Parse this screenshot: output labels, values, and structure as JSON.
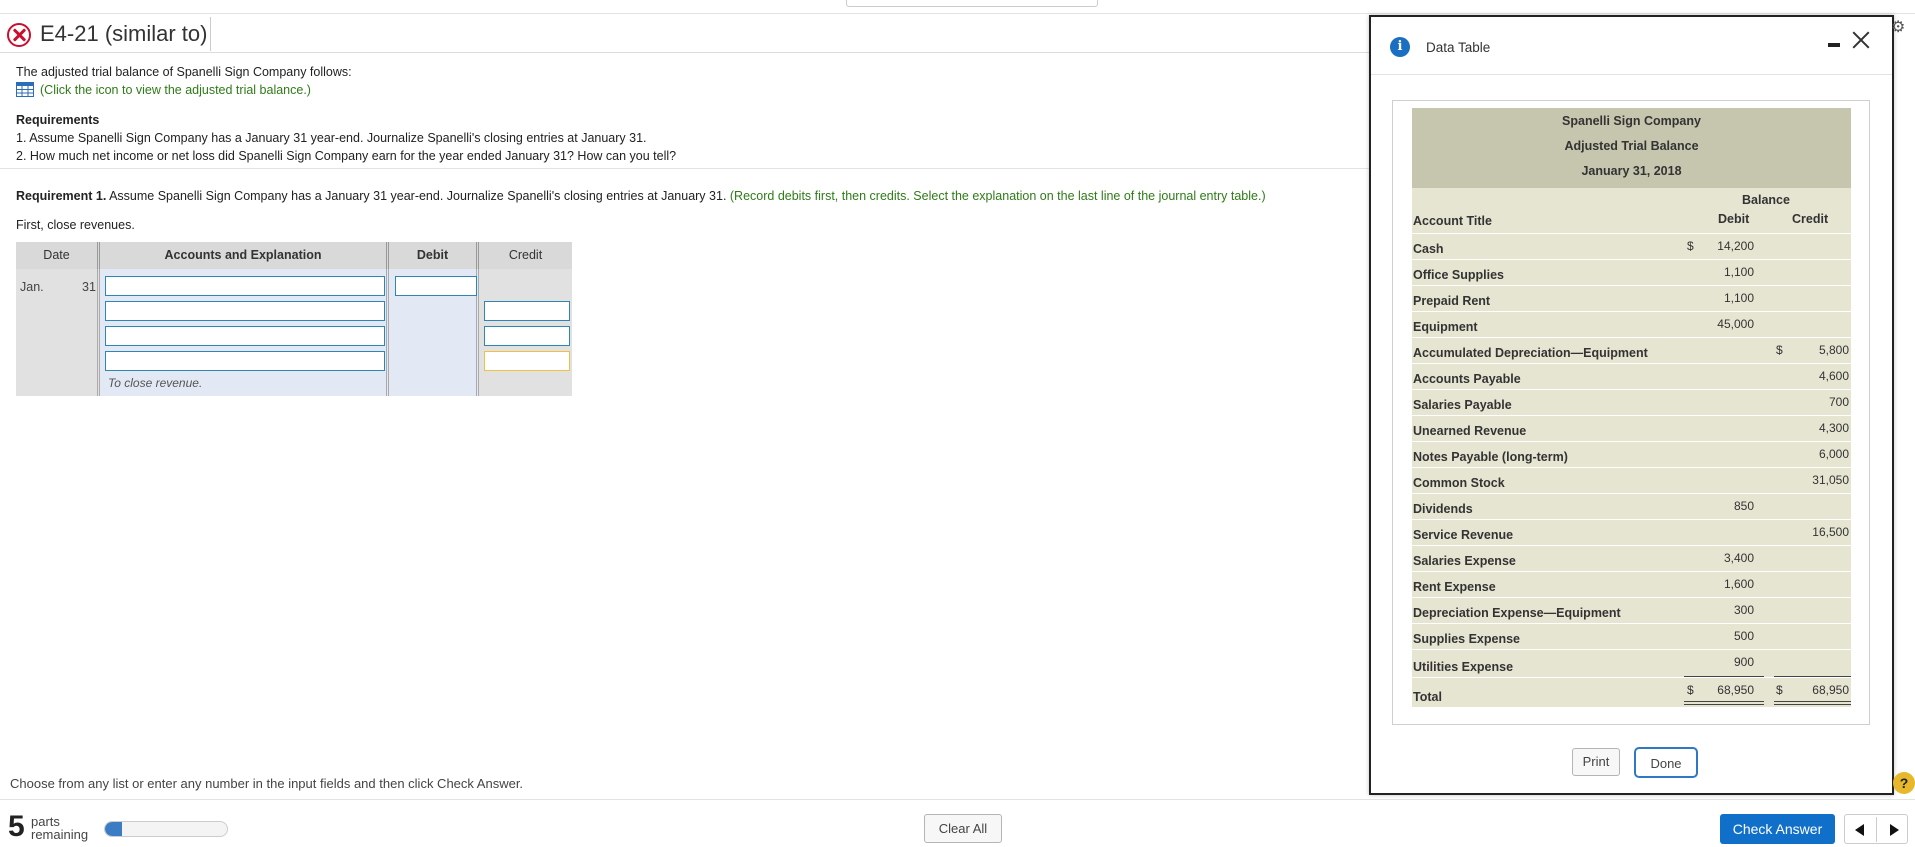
{
  "header": {
    "title": "E4-21 (similar to)"
  },
  "problem": {
    "intro": "The adjusted trial balance of Spanelli Sign Company follows:",
    "link_text": "(Click the icon to view the adjusted trial balance.)",
    "requirements_heading": "Requirements",
    "req1_text": "1. Assume Spanelli Sign Company has a January 31 year-end. Journalize Spanelli's closing entries at January 31.",
    "req2_text": "2. How much net income or net loss did Spanelli Sign Company earn for the year ended January 31? How can you tell?"
  },
  "requirement1": {
    "label": "Requirement 1.",
    "text": " Assume Spanelli Sign Company has a January 31 year-end. Journalize Spanelli's closing entries at January 31. ",
    "instruction": "(Record debits first, then credits. Select the explanation on the last line of the journal entry table.)",
    "step": "First, close revenues."
  },
  "journal": {
    "headers": {
      "date": "Date",
      "accounts": "Accounts and Explanation",
      "debit": "Debit",
      "credit": "Credit"
    },
    "month": "Jan.",
    "day": "31",
    "explanation": "To close revenue."
  },
  "footer": {
    "choose_text": "Choose from any list or enter any number in the input fields and then click Check Answer.",
    "parts_count": "5",
    "parts_label_1": "parts",
    "parts_label_2": "remaining",
    "progress_fraction": 0.14,
    "clear_all": "Clear All",
    "check_answer": "Check Answer"
  },
  "modal": {
    "title": "Data Table",
    "print": "Print",
    "done": "Done",
    "table": {
      "company": "Spanelli Sign Company",
      "statement": "Adjusted Trial Balance",
      "date": "January 31, 2018",
      "balance_header": "Balance",
      "debit_header": "Debit",
      "credit_header": "Credit",
      "account_header": "Account Title",
      "rows": [
        {
          "account": "Cash",
          "debit_sign": "$",
          "debit": "14,200",
          "credit_sign": "",
          "credit": ""
        },
        {
          "account": "Office Supplies",
          "debit_sign": "",
          "debit": "1,100",
          "credit_sign": "",
          "credit": ""
        },
        {
          "account": "Prepaid Rent",
          "debit_sign": "",
          "debit": "1,100",
          "credit_sign": "",
          "credit": ""
        },
        {
          "account": "Equipment",
          "debit_sign": "",
          "debit": "45,000",
          "credit_sign": "",
          "credit": ""
        },
        {
          "account": "Accumulated Depreciation—Equipment",
          "debit_sign": "",
          "debit": "",
          "credit_sign": "$",
          "credit": "5,800"
        },
        {
          "account": "Accounts Payable",
          "debit_sign": "",
          "debit": "",
          "credit_sign": "",
          "credit": "4,600"
        },
        {
          "account": "Salaries Payable",
          "debit_sign": "",
          "debit": "",
          "credit_sign": "",
          "credit": "700"
        },
        {
          "account": "Unearned Revenue",
          "debit_sign": "",
          "debit": "",
          "credit_sign": "",
          "credit": "4,300"
        },
        {
          "account": "Notes Payable (long-term)",
          "debit_sign": "",
          "debit": "",
          "credit_sign": "",
          "credit": "6,000"
        },
        {
          "account": "Common Stock",
          "debit_sign": "",
          "debit": "",
          "credit_sign": "",
          "credit": "31,050"
        },
        {
          "account": "Dividends",
          "debit_sign": "",
          "debit": "850",
          "credit_sign": "",
          "credit": ""
        },
        {
          "account": "Service Revenue",
          "debit_sign": "",
          "debit": "",
          "credit_sign": "",
          "credit": "16,500"
        },
        {
          "account": "Salaries Expense",
          "debit_sign": "",
          "debit": "3,400",
          "credit_sign": "",
          "credit": ""
        },
        {
          "account": "Rent Expense",
          "debit_sign": "",
          "debit": "1,600",
          "credit_sign": "",
          "credit": ""
        },
        {
          "account": "Depreciation Expense—Equipment",
          "debit_sign": "",
          "debit": "300",
          "credit_sign": "",
          "credit": ""
        },
        {
          "account": "Supplies Expense",
          "debit_sign": "",
          "debit": "500",
          "credit_sign": "",
          "credit": ""
        },
        {
          "account": "Utilities Expense",
          "debit_sign": "",
          "debit": "900",
          "credit_sign": "",
          "credit": ""
        }
      ],
      "total": {
        "account": "Total",
        "debit_sign": "$",
        "debit": "68,950",
        "credit_sign": "$",
        "credit": "68,950"
      }
    }
  },
  "colors": {
    "accent_blue": "#1070c9",
    "error_red": "#c8102e",
    "instruction_green": "#2f7b18",
    "table_header_tan": "#c6c5ae",
    "table_body_tan": "#e6e5d2"
  }
}
